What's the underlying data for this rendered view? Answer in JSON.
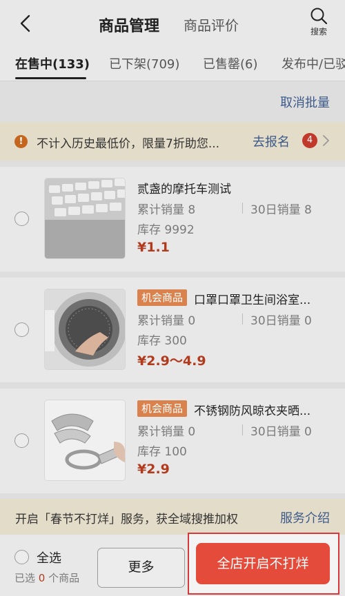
{
  "header": {
    "title_active": "商品管理",
    "title_inactive": "商品评价",
    "search_label": "搜索"
  },
  "tabs": [
    {
      "label": "在售中(133)"
    },
    {
      "label": "已下架(709)"
    },
    {
      "label": "已售罄(6)"
    },
    {
      "label": "发布中/已驳"
    }
  ],
  "batch": {
    "cancel_label": "取消批量"
  },
  "notice": {
    "icon_text": "!",
    "text": "不计入历史最低价，限量7折助您...",
    "link": "去报名",
    "badge": "4"
  },
  "products": [
    {
      "chip": "",
      "name": "贰盏的摩托车测试",
      "total_sales": "累计销量 8",
      "sales_30d": "30日销量 8",
      "stock": "库存 9992",
      "price": "¥1.1",
      "image": "keyboard"
    },
    {
      "chip": "机会商品",
      "name": "口罩口罩卫生间浴室...",
      "total_sales": "累计销量 0",
      "sales_30d": "30日销量 0",
      "stock": "库存 300",
      "price": "¥2.9～4.9",
      "image": "washing-machine"
    },
    {
      "chip": "机会商品",
      "name": "不锈钢防风晾衣夹晒...",
      "total_sales": "累计销量 0",
      "sales_30d": "30日销量 0",
      "stock": "库存 100",
      "price": "¥2.9",
      "image": "clothes-clip"
    }
  ],
  "promo": {
    "text": "开启「春节不打烊」服务，获全域搜推加权",
    "link": "服务介绍"
  },
  "bottom": {
    "select_all": "全选",
    "selected_prefix": "已选 ",
    "selected_count": "0",
    "selected_suffix": " 个商品",
    "more": "更多",
    "cta": "全店开启不打烊"
  },
  "colors": {
    "accent": "#e44b3a",
    "link": "#3d5a8a",
    "price": "#b23b1e",
    "chip": "#d9824e"
  }
}
